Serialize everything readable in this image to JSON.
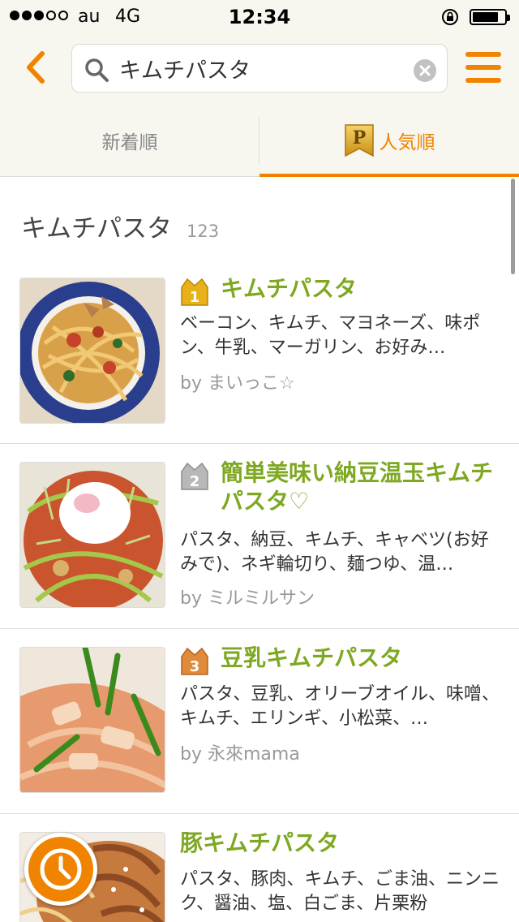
{
  "status_bar": {
    "carrier": "au",
    "network": "4G",
    "time": "12:34",
    "battery_level": 0.82
  },
  "header": {
    "search_value": "キムチパスタ",
    "icons": {
      "back": "chevron-left-icon",
      "search": "search-icon",
      "clear": "clear-icon",
      "menu": "hamburger-menu-icon"
    }
  },
  "tabs": [
    {
      "label": "新着順",
      "active": false
    },
    {
      "label": "人気順",
      "active": true,
      "badge": "P"
    }
  ],
  "results": {
    "title": "キムチパスタ",
    "count": "123"
  },
  "recipes": [
    {
      "rank": "1",
      "title": "キムチパスタ",
      "ingredients": "ベーコン、キムチ、マヨネーズ、味ポン、牛乳、マーガリン、お好み…",
      "author": "by まいっこ☆"
    },
    {
      "rank": "2",
      "title": "簡単美味い納豆温玉キムチパスタ♡",
      "ingredients": "パスタ、納豆、キムチ、キャベツ(お好みで)、ネギ輪切り、麺つゆ、温…",
      "author": "by ミルミルサン"
    },
    {
      "rank": "3",
      "title": "豆乳キムチパスタ",
      "ingredients": "パスタ、豆乳、オリーブオイル、味噌、キムチ、エリンギ、小松菜、…",
      "author": "by 永來mama"
    },
    {
      "rank": "",
      "title": "豚キムチパスタ",
      "ingredients": "パスタ、豚肉、キムチ、ごま油、ニンニク、醤油、塩、白ごま、片栗粉"
    }
  ],
  "colors": {
    "accent": "#f08300",
    "title_green": "#7ea822",
    "bar_bg": "#f7f6ef",
    "rank_gold": "#e8b019",
    "rank_silver": "#b8b8b8",
    "rank_bronze": "#e08a3c"
  },
  "floating": {
    "icon": "clock-icon"
  }
}
